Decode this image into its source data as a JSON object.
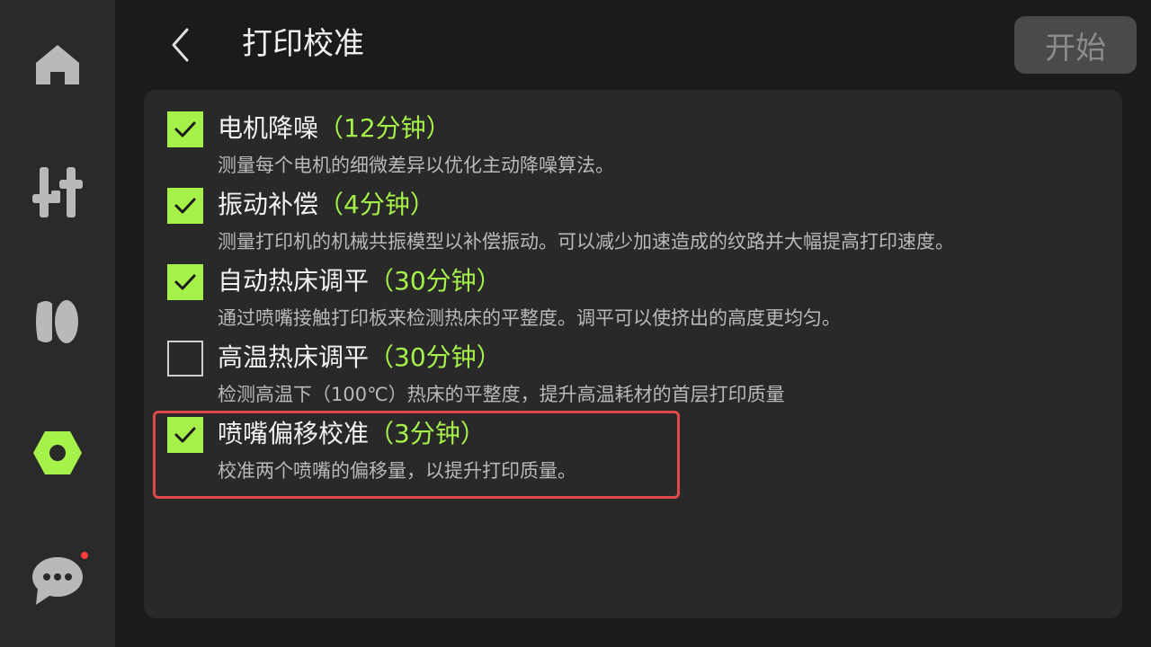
{
  "header": {
    "title": "打印校准",
    "start_label": "开始"
  },
  "sidebar": {
    "items": [
      {
        "icon": "home-icon",
        "active": false
      },
      {
        "icon": "sliders-icon",
        "active": false
      },
      {
        "icon": "filament-icon",
        "active": false
      },
      {
        "icon": "hex-nut-icon",
        "active": true
      },
      {
        "icon": "chat-icon",
        "active": false,
        "notification": true
      }
    ]
  },
  "calibration": {
    "items": [
      {
        "title": "电机降噪",
        "duration": "（12分钟）",
        "description": "测量每个电机的细微差异以优化主动降噪算法。",
        "checked": true
      },
      {
        "title": "振动补偿",
        "duration": "（4分钟）",
        "description": "测量打印机的机械共振模型以补偿振动。可以减少加速造成的纹路并大幅提高打印速度。",
        "checked": true
      },
      {
        "title": "自动热床调平",
        "duration": "（30分钟）",
        "description": "通过喷嘴接触打印板来检测热床的平整度。调平可以使挤出的高度更均匀。",
        "checked": true
      },
      {
        "title": "高温热床调平",
        "duration": "（30分钟）",
        "description": "检测高温下（100℃）热床的平整度，提升高温耗材的首层打印质量",
        "checked": false
      },
      {
        "title": "喷嘴偏移校准",
        "duration": "（3分钟）",
        "description": "校准两个喷嘴的偏移量，以提升打印质量。",
        "checked": true
      }
    ]
  },
  "colors": {
    "accent": "#a6f04a",
    "highlight_border": "#e04a4a",
    "notification": "#ff3b3b"
  }
}
